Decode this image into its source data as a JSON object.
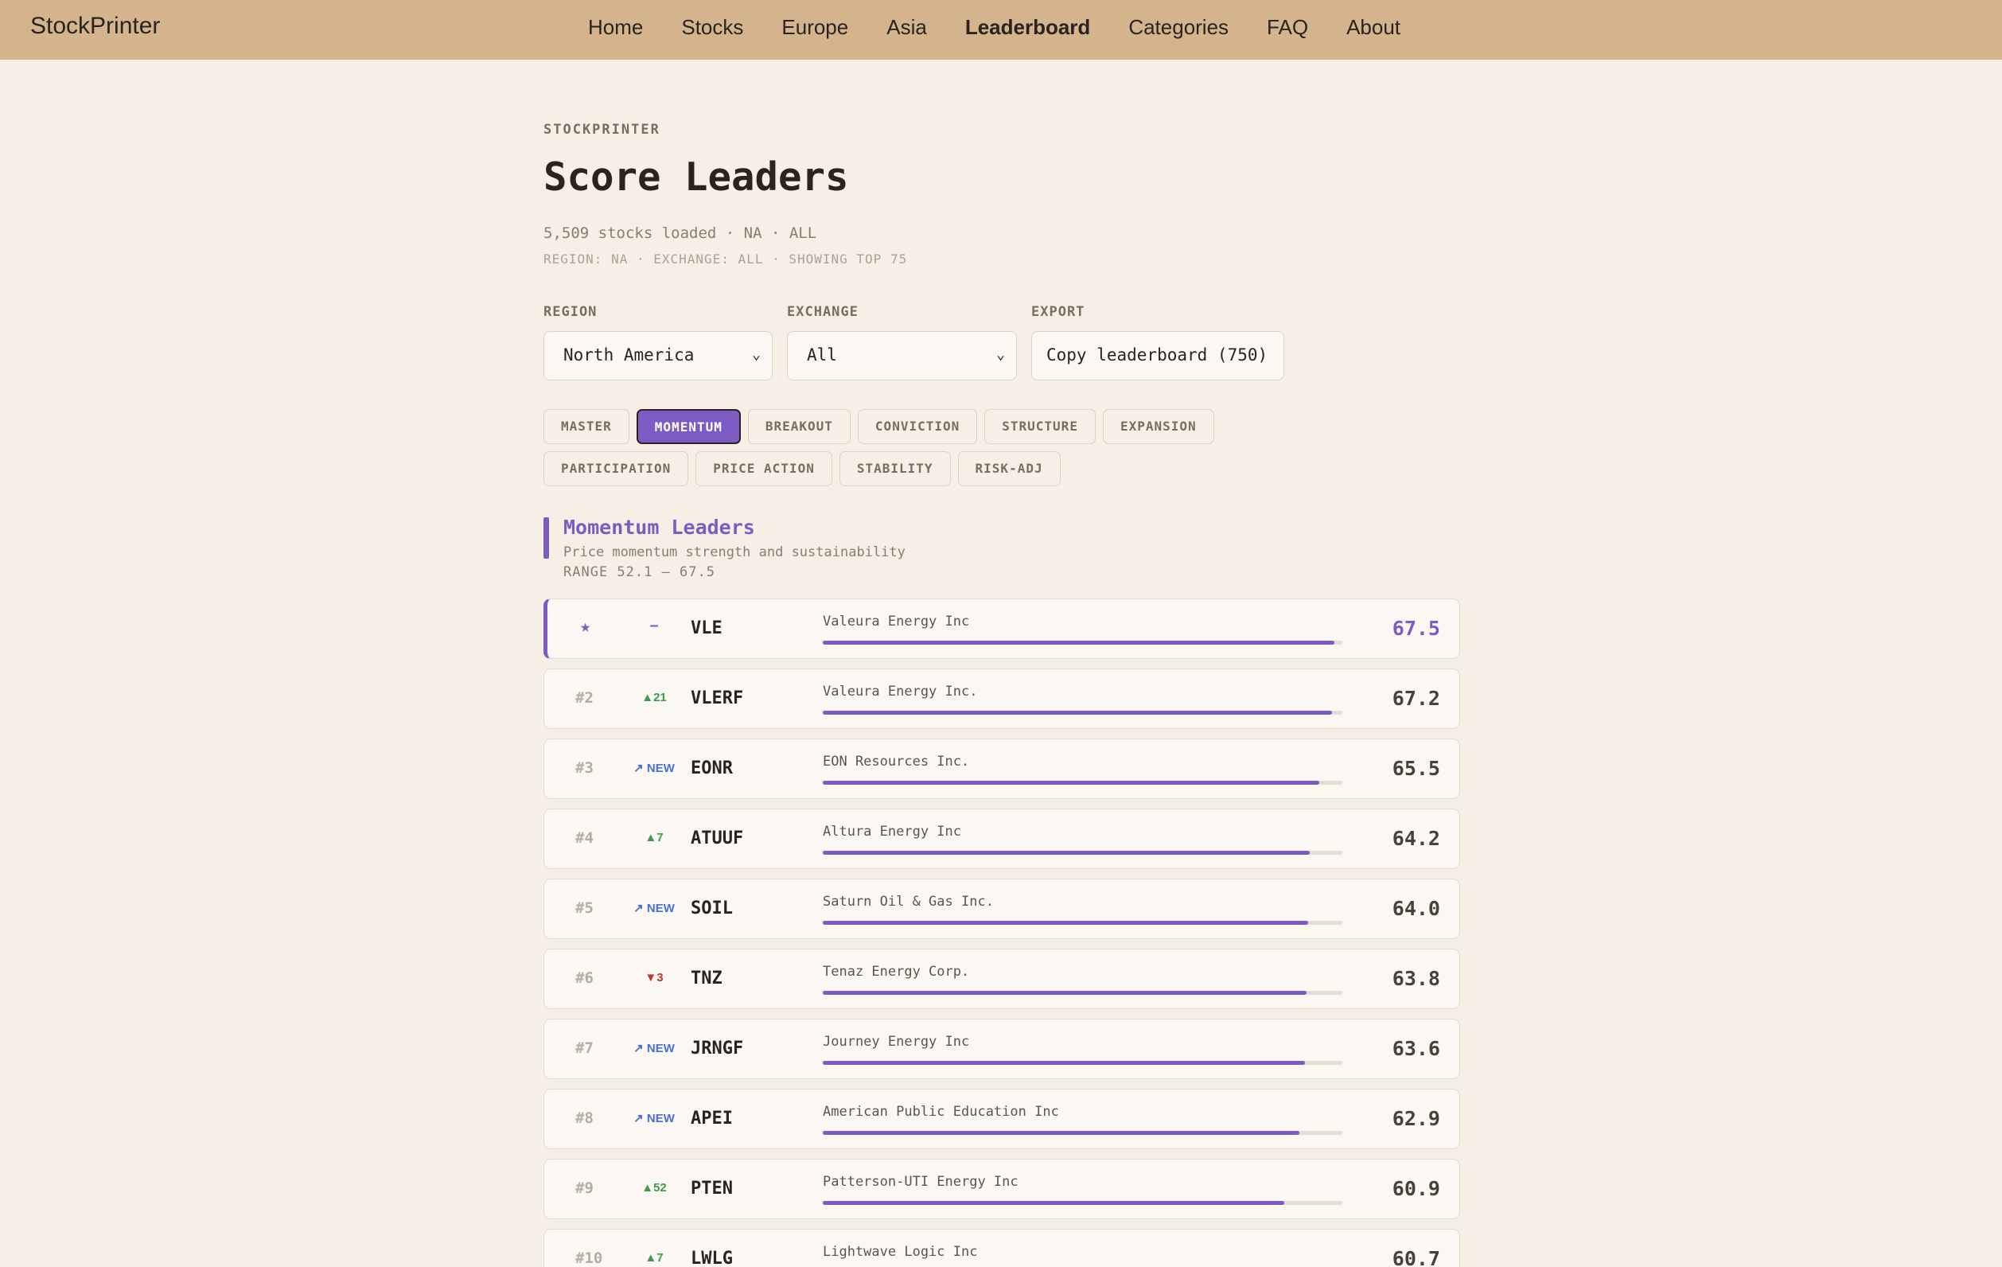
{
  "brand": "StockPrinter",
  "nav": [
    {
      "label": "Home",
      "active": false
    },
    {
      "label": "Stocks",
      "active": false
    },
    {
      "label": "Europe",
      "active": false
    },
    {
      "label": "Asia",
      "active": false
    },
    {
      "label": "Leaderboard",
      "active": true
    },
    {
      "label": "Categories",
      "active": false
    },
    {
      "label": "FAQ",
      "active": false
    },
    {
      "label": "About",
      "active": false
    }
  ],
  "page": {
    "eyebrow": "STOCKPRINTER",
    "title": "Score Leaders",
    "meta_line": "5,509 stocks loaded · NA · ALL",
    "meta_sub": "REGION: NA · EXCHANGE: ALL · SHOWING TOP 75"
  },
  "controls": {
    "region_label": "REGION",
    "region_value": "North America",
    "exchange_label": "EXCHANGE",
    "exchange_value": "All",
    "export_label": "EXPORT",
    "export_button": "Copy leaderboard (750)"
  },
  "tabs_row1": [
    {
      "label": "MASTER",
      "active": false
    },
    {
      "label": "MOMENTUM",
      "active": true
    },
    {
      "label": "BREAKOUT",
      "active": false
    },
    {
      "label": "CONVICTION",
      "active": false
    },
    {
      "label": "STRUCTURE",
      "active": false
    },
    {
      "label": "EXPANSION",
      "active": false
    }
  ],
  "tabs_row2": [
    {
      "label": "PARTICIPATION",
      "active": false
    },
    {
      "label": "PRICE ACTION",
      "active": false
    },
    {
      "label": "STABILITY",
      "active": false
    },
    {
      "label": "RISK-ADJ",
      "active": false
    }
  ],
  "section": {
    "title": "Momentum Leaders",
    "subtitle": "Price momentum strength and sustainability",
    "range": "RANGE 52.1 – 67.5"
  },
  "accent_color": "#7c5cc4",
  "score_max": 67.5,
  "leaders": [
    {
      "rank": "★",
      "movement": "–",
      "move_type": "none",
      "ticker": "VLE",
      "company": "Valeura Energy Inc",
      "score": "67.5",
      "leader": true
    },
    {
      "rank": "#2",
      "movement": "▲21",
      "move_type": "up",
      "ticker": "VLERF",
      "company": "Valeura Energy Inc.",
      "score": "67.2",
      "leader": false
    },
    {
      "rank": "#3",
      "movement": "↗ NEW",
      "move_type": "new",
      "ticker": "EONR",
      "company": "EON Resources Inc.",
      "score": "65.5",
      "leader": false
    },
    {
      "rank": "#4",
      "movement": "▲7",
      "move_type": "up",
      "ticker": "ATUUF",
      "company": "Altura Energy Inc",
      "score": "64.2",
      "leader": false
    },
    {
      "rank": "#5",
      "movement": "↗ NEW",
      "move_type": "new",
      "ticker": "SOIL",
      "company": "Saturn Oil & Gas Inc.",
      "score": "64.0",
      "leader": false
    },
    {
      "rank": "#6",
      "movement": "▼3",
      "move_type": "down",
      "ticker": "TNZ",
      "company": "Tenaz Energy Corp.",
      "score": "63.8",
      "leader": false
    },
    {
      "rank": "#7",
      "movement": "↗ NEW",
      "move_type": "new",
      "ticker": "JRNGF",
      "company": "Journey Energy Inc",
      "score": "63.6",
      "leader": false
    },
    {
      "rank": "#8",
      "movement": "↗ NEW",
      "move_type": "new",
      "ticker": "APEI",
      "company": "American Public Education Inc",
      "score": "62.9",
      "leader": false
    },
    {
      "rank": "#9",
      "movement": "▲52",
      "move_type": "up",
      "ticker": "PTEN",
      "company": "Patterson-UTI Energy Inc",
      "score": "60.9",
      "leader": false
    },
    {
      "rank": "#10",
      "movement": "▲7",
      "move_type": "up",
      "ticker": "LWLG",
      "company": "Lightwave Logic Inc",
      "score": "60.7",
      "leader": false
    }
  ]
}
